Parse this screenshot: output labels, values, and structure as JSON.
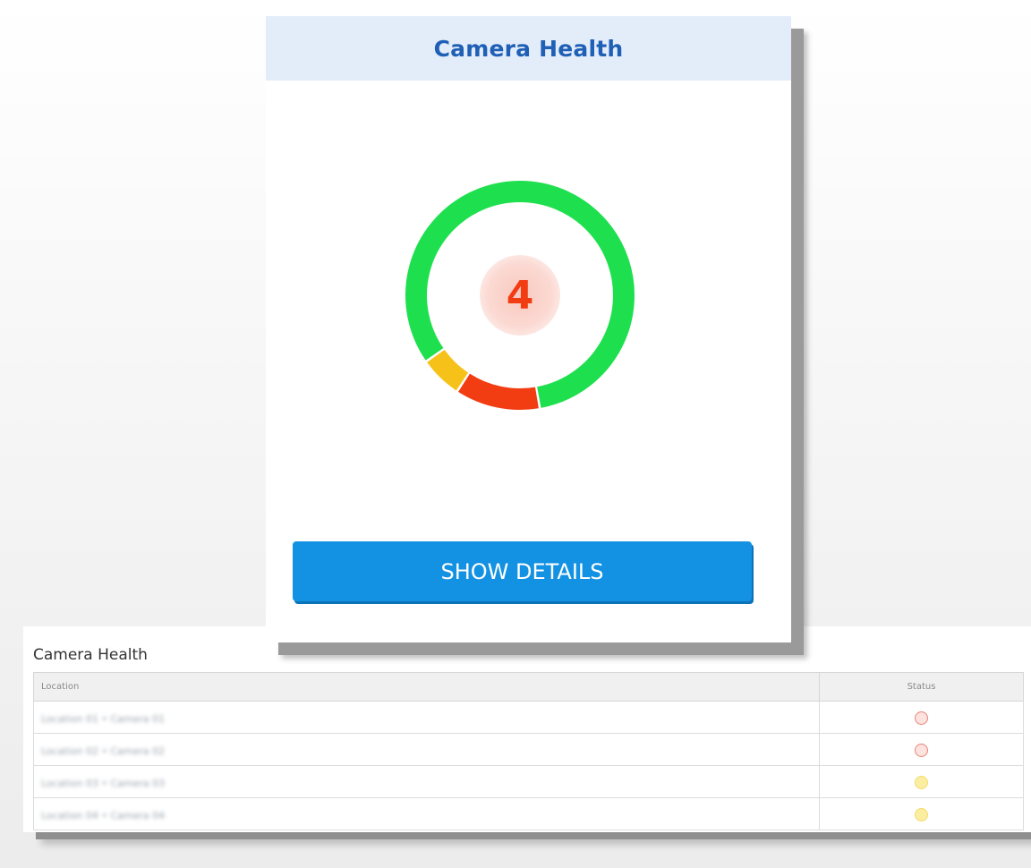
{
  "widget": {
    "title": "Camera Health",
    "count": "4",
    "button_label": "SHOW DETAILS",
    "segments": [
      {
        "status": "healthy",
        "color": "#1ee04e",
        "fraction": 0.82
      },
      {
        "status": "offline",
        "color": "#f23c12",
        "fraction": 0.12
      },
      {
        "status": "warning",
        "color": "#f6c21a",
        "fraction": 0.06
      }
    ]
  },
  "table": {
    "title": "Camera Health",
    "columns": {
      "location": "Location",
      "status": "Status"
    },
    "rows": [
      {
        "location": "Location 01 • Camera 01",
        "status": "red"
      },
      {
        "location": "Location 02 • Camera 02",
        "status": "red"
      },
      {
        "location": "Location 03 • Camera 03",
        "status": "yellow"
      },
      {
        "location": "Location 04 • Camera 04",
        "status": "yellow"
      }
    ]
  },
  "colors": {
    "header_bg": "#e3edf9",
    "title_blue": "#1f5fb5",
    "button_blue": "#1391e2",
    "status_red": "#e8857a",
    "status_yellow": "#f2dc6a"
  }
}
